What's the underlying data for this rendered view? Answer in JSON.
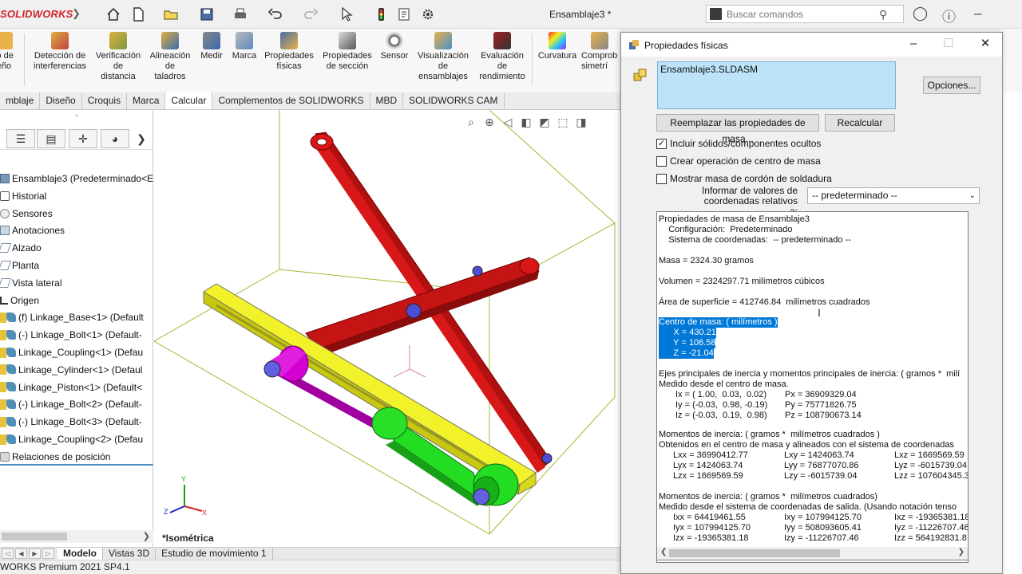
{
  "app": {
    "logo": "SOLIDWORKS",
    "doc_title": "Ensamblaje3 *",
    "search_placeholder": "Buscar comandos"
  },
  "ribbon": {
    "items": [
      {
        "label": "io de\neño",
        "icon": "mass-properties-icon"
      },
      {
        "label": "Detección de\ninterferencias",
        "icon": "interference-icon"
      },
      {
        "label": "Verificación\nde\ndistancia",
        "icon": "clearance-icon"
      },
      {
        "label": "Alineación\nde\ntaladros",
        "icon": "hole-align-icon"
      },
      {
        "label": "Medir",
        "icon": "measure-icon"
      },
      {
        "label": "Marca",
        "icon": "markup-icon"
      },
      {
        "label": "Propiedades\nfísicas",
        "icon": "mass-properties-icon"
      },
      {
        "label": "Propiedades\nde sección",
        "icon": "section-properties-icon"
      },
      {
        "label": "Sensor",
        "icon": "sensor-icon"
      },
      {
        "label": "Visualización\nde\nensamblajes",
        "icon": "assembly-visualization-icon"
      },
      {
        "label": "Evaluación\nde\nrendimiento",
        "icon": "performance-icon"
      },
      {
        "label": "Curvatura",
        "icon": "curvature-icon"
      },
      {
        "label": "Comprob\nsimetrí",
        "icon": "symmetry-check-icon"
      }
    ]
  },
  "tabs": [
    "mblaje",
    "Diseño",
    "Croquis",
    "Marca",
    "Calcular",
    "Complementos de SOLIDWORKS",
    "MBD",
    "SOLIDWORKS CAM"
  ],
  "active_tab": "Calcular",
  "tree": {
    "items": [
      {
        "label": "Ensamblaje3  (Predeterminado<E",
        "kind": "asm"
      },
      {
        "label": "Historial",
        "kind": "hist"
      },
      {
        "label": "Sensores",
        "kind": "sens"
      },
      {
        "label": "Anotaciones",
        "kind": "ann"
      },
      {
        "label": "Alzado",
        "kind": "plane"
      },
      {
        "label": "Planta",
        "kind": "plane"
      },
      {
        "label": "Vista lateral",
        "kind": "plane"
      },
      {
        "label": "Origen",
        "kind": "orig"
      },
      {
        "label": "(f) Linkage_Base<1> (Default",
        "kind": "part"
      },
      {
        "label": "(-) Linkage_Bolt<1> (Default-",
        "kind": "part"
      },
      {
        "label": "Linkage_Coupling<1> (Defau",
        "kind": "part"
      },
      {
        "label": "Linkage_Cylinder<1> (Defaul",
        "kind": "part"
      },
      {
        "label": "Linkage_Piston<1> (Default<",
        "kind": "part"
      },
      {
        "label": "(-) Linkage_Bolt<2> (Default-",
        "kind": "part"
      },
      {
        "label": "(-) Linkage_Bolt<3> (Default-",
        "kind": "part"
      },
      {
        "label": "Linkage_Coupling<2> (Defau",
        "kind": "part"
      },
      {
        "label": "Relaciones de posición",
        "kind": "mate"
      }
    ]
  },
  "viewport": {
    "view_name": "*Isométrica",
    "colors": {
      "arm": "#c41414",
      "base": "#e8e81e",
      "cylinder": "#22dd22",
      "piston": "#d400d4",
      "bolt": "#5a5ad0"
    }
  },
  "bottom_tabs": [
    "Modelo",
    "Vistas 3D",
    "Estudio de movimiento 1"
  ],
  "status": "WORKS Premium 2021 SP4.1",
  "dialog": {
    "title": "Propiedades físicas",
    "selected": "Ensamblaje3.SLDASM",
    "options_btn": "Opciones...",
    "replace_btn": "Reemplazar las propiedades de masa...",
    "recalc_btn": "Recalcular",
    "checks": [
      {
        "label": "Incluir sólidos/componentes ocultos",
        "checked": true
      },
      {
        "label": "Crear operación de centro de masa",
        "checked": false
      },
      {
        "label": "Mostrar masa de cordón de soldadura",
        "checked": false
      }
    ],
    "coord_label": "Informar de valores de coordenadas relativos a:",
    "coord_value": "-- predeterminado --",
    "report": {
      "header": "Propiedades de masa de Ensamblaje3",
      "config": "    Configuración:  Predeterminado",
      "system": "    Sistema de coordenadas:  -- predeterminado --",
      "mass": "Masa = 2324.30 gramos",
      "volume": "Volumen = 2324297.71 milímetros cúbicos",
      "area": "Área de superficie = 412746.84  milímetros cuadrados",
      "com_title": "Centro de masa: ( milímetros )",
      "com_x": "      X = 430.21",
      "com_y": "      Y = 106.58",
      "com_z": "      Z = -21.04",
      "axes_title": "Ejes principales de inercia y momentos principales de inercia: ( gramos *  milí",
      "axes_sub": "Medido desde el centro de masa.",
      "axes": [
        {
          "i": "Ix = ( 1.00,  0.03,  0.02)",
          "p": "Px = 36909329.04"
        },
        {
          "i": "Iy = (-0.03,  0.98, -0.19)",
          "p": "Py = 75771826.75"
        },
        {
          "i": "Iz = (-0.03,  0.19,  0.98)",
          "p": "Pz = 108790673.14"
        }
      ],
      "moi1_title": "Momentos de inercia: ( gramos *  milímetros cuadrados )",
      "moi1_sub": "Obtenidos en el centro de masa y alineados con el sistema de coordenadas",
      "moi1": [
        [
          "Lxx = 36990412.77",
          "Lxy = 1424063.74",
          "Lxz = 1669569.59"
        ],
        [
          "Lyx = 1424063.74",
          "Lyy = 76877070.86",
          "Lyz = -6015739.04"
        ],
        [
          "Lzx = 1669569.59",
          "Lzy = -6015739.04",
          "Lzz = 107604345.3"
        ]
      ],
      "moi2_title": "Momentos de inercia: ( gramos *  milímetros cuadrados)",
      "moi2_sub": "Medido desde el sistema de coordenadas de salida. (Usando notación tenso",
      "moi2": [
        [
          "Ixx = 64419461.55",
          "Ixy = 107994125.70",
          "Ixz = -19365381.18"
        ],
        [
          "Iyx = 107994125.70",
          "Iyy = 508093605.41",
          "Iyz = -11226707.46"
        ],
        [
          "Izx = -19365381.18",
          "Izy = -11226707.46",
          "Izz = 564192831.8"
        ]
      ]
    }
  }
}
